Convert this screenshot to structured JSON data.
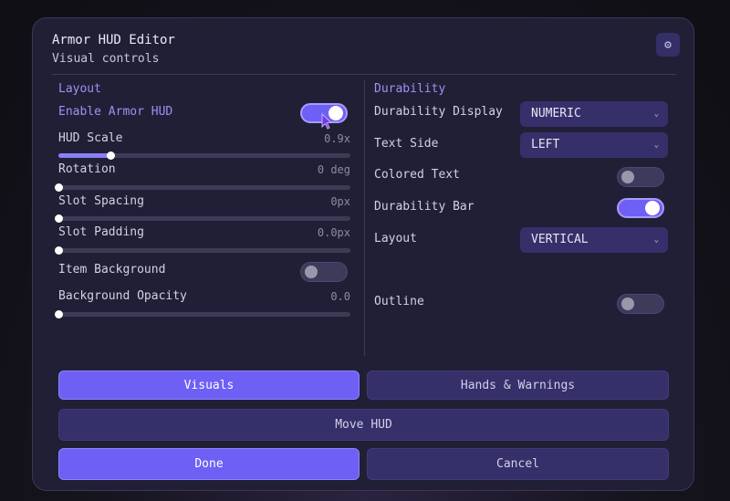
{
  "window": {
    "title": "Armor HUD Editor",
    "subtitle": "Visual controls",
    "settings_icon": "⚙"
  },
  "layout": {
    "section_title": "Layout",
    "enable_label": "Enable Armor HUD",
    "enable_on": true,
    "hud_scale": {
      "label": "HUD Scale",
      "value": "0.9x",
      "fraction": 0.18
    },
    "rotation": {
      "label": "Rotation",
      "value": "0 deg",
      "fraction": 0
    },
    "slot_spacing": {
      "label": "Slot Spacing",
      "value": "0px",
      "fraction": 0
    },
    "slot_padding": {
      "label": "Slot Padding",
      "value": "0.0px",
      "fraction": 0
    },
    "item_background": {
      "label": "Item Background",
      "on": false
    },
    "background_opacity": {
      "label": "Background Opacity",
      "value": "0.0",
      "fraction": 0
    }
  },
  "durability": {
    "section_title": "Durability",
    "display": {
      "label": "Durability Display",
      "value": "NUMERIC"
    },
    "text_side": {
      "label": "Text Side",
      "value": "LEFT"
    },
    "colored_text": {
      "label": "Colored Text",
      "on": false
    },
    "durability_bar": {
      "label": "Durability Bar",
      "on": true
    },
    "layout": {
      "label": "Layout",
      "value": "VERTICAL"
    },
    "outline": {
      "label": "Outline",
      "on": false
    }
  },
  "tabs": {
    "visuals": "Visuals",
    "hands_warnings": "Hands & Warnings",
    "active": "visuals"
  },
  "buttons": {
    "move_hud": "Move HUD",
    "done": "Done",
    "cancel": "Cancel"
  },
  "colors": {
    "accent": "#6e5ff5",
    "panel": "#211f35",
    "section": "#9b93f5"
  }
}
